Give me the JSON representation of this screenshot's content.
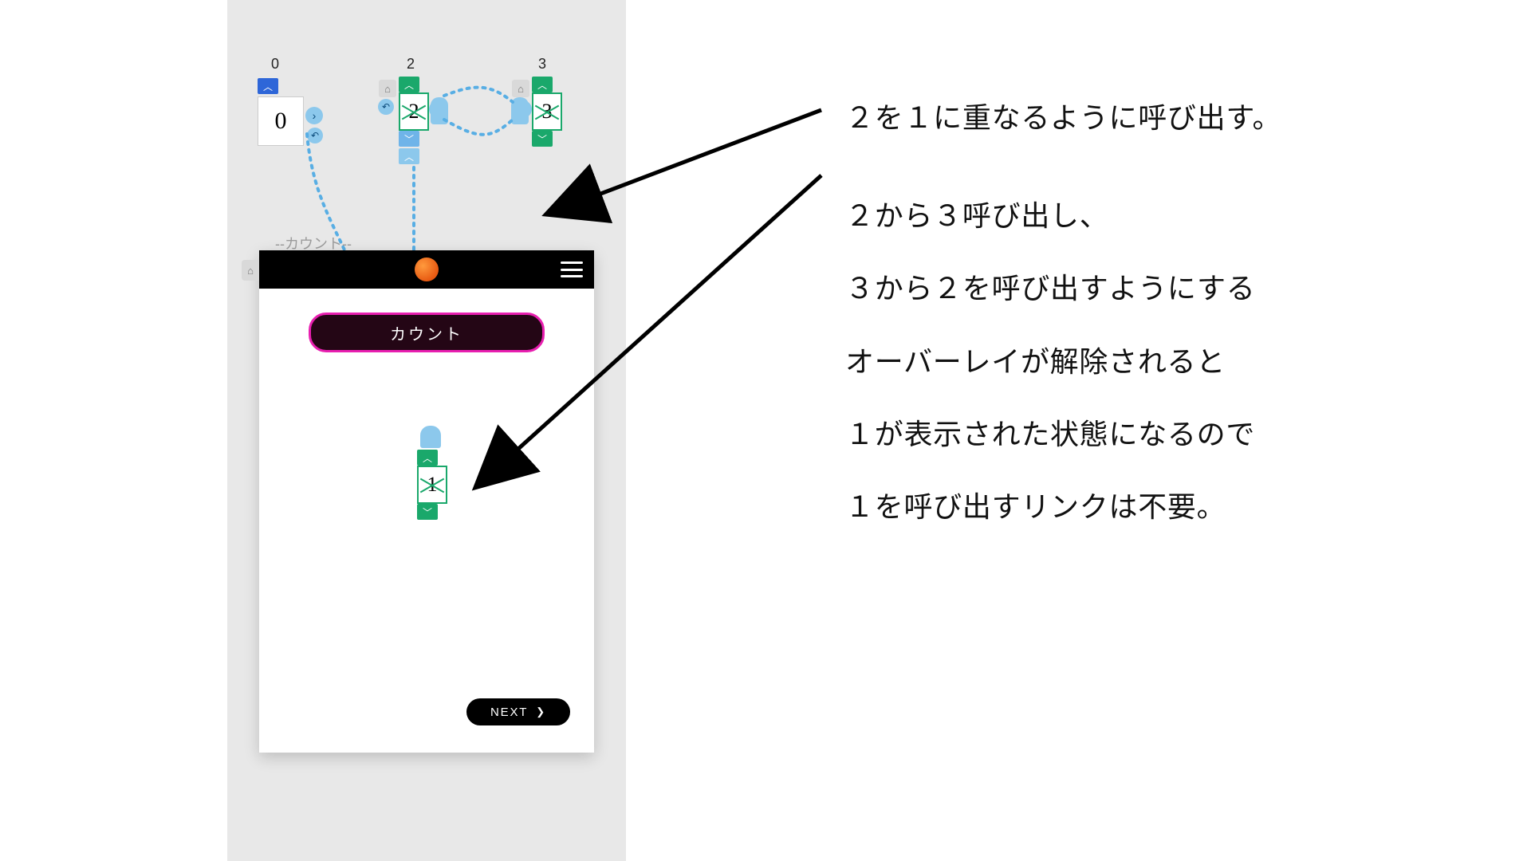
{
  "columns": {
    "c0": "0",
    "c2": "2",
    "c3": "3"
  },
  "tiles": {
    "t0": "0",
    "t2": "2",
    "t3": "3",
    "t1": "1"
  },
  "preview_label": "--カウント--",
  "pill_label": "カウント",
  "next_label": "NEXT",
  "notes": {
    "l1": "２を１に重なるように呼び出す。",
    "l2": "２から３呼び出し、",
    "l3": "３から２を呼び出すようにする",
    "l4": "オーバーレイが解除されると",
    "l5": "１が表示された状態になるので",
    "l6": "１を呼び出すリンクは不要。"
  }
}
